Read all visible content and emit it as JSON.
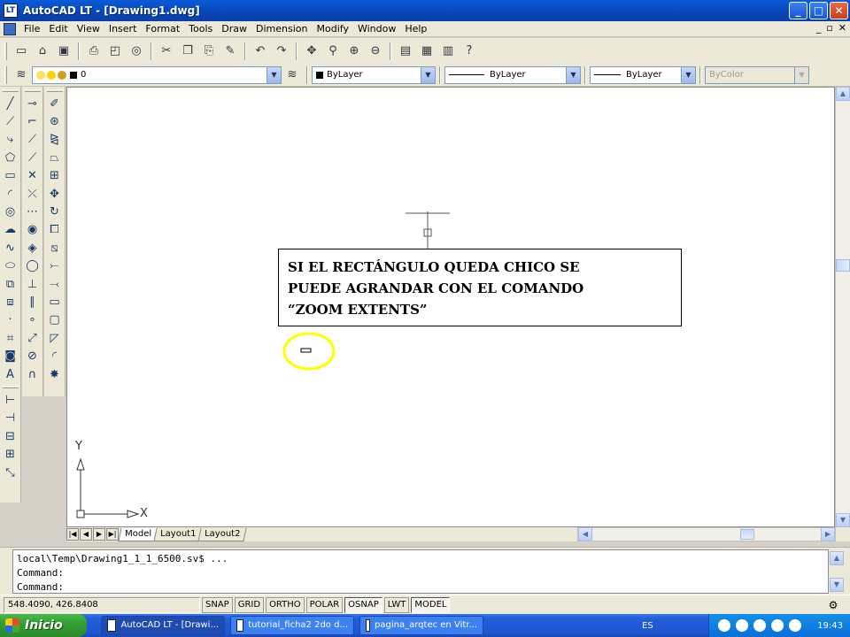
{
  "window": {
    "title": "AutoCAD LT - [Drawing1.dwg]",
    "buttons": {
      "minimize": "_",
      "maximize": "□",
      "close": "✕"
    }
  },
  "menubar": {
    "items": [
      "File",
      "Edit",
      "View",
      "Insert",
      "Format",
      "Tools",
      "Draw",
      "Dimension",
      "Modify",
      "Window",
      "Help"
    ],
    "doc_controls": [
      "_",
      "▫",
      "✕"
    ]
  },
  "properties_toolbar": {
    "layer": "0",
    "color": "ByLayer",
    "linetype": "ByLayer",
    "lineweight": "ByLayer",
    "plotstyle": "ByColor"
  },
  "annotation": {
    "text": "SI EL RECTÁNGULO QUEDA CHICO SE\nPUEDE AGRANDAR CON EL COMANDO\n“ZOOM EXTENTS”",
    "highlight_color": "#ffff00"
  },
  "ucs": {
    "x_label": "X",
    "y_label": "Y"
  },
  "layout_tabs": [
    "Model",
    "Layout1",
    "Layout2"
  ],
  "command_window": {
    "lines": [
      "local\\Temp\\Drawing1_1_1_6500.sv$ ...",
      "Command:",
      "Command:"
    ]
  },
  "statusbar": {
    "coords": "548.4090, 426.8408",
    "toggles": [
      {
        "label": "SNAP",
        "on": false
      },
      {
        "label": "GRID",
        "on": false
      },
      {
        "label": "ORTHO",
        "on": false
      },
      {
        "label": "POLAR",
        "on": false
      },
      {
        "label": "OSNAP",
        "on": true
      },
      {
        "label": "LWT",
        "on": false
      },
      {
        "label": "MODEL",
        "on": true
      }
    ]
  },
  "taskbar": {
    "start": "Inicio",
    "tasks": [
      "AutoCAD LT - [Drawi...",
      "tutorial_ficha2 2do d...",
      "pagina_arqtec en Vitr..."
    ],
    "lang": "ES",
    "clock": "19:43"
  }
}
